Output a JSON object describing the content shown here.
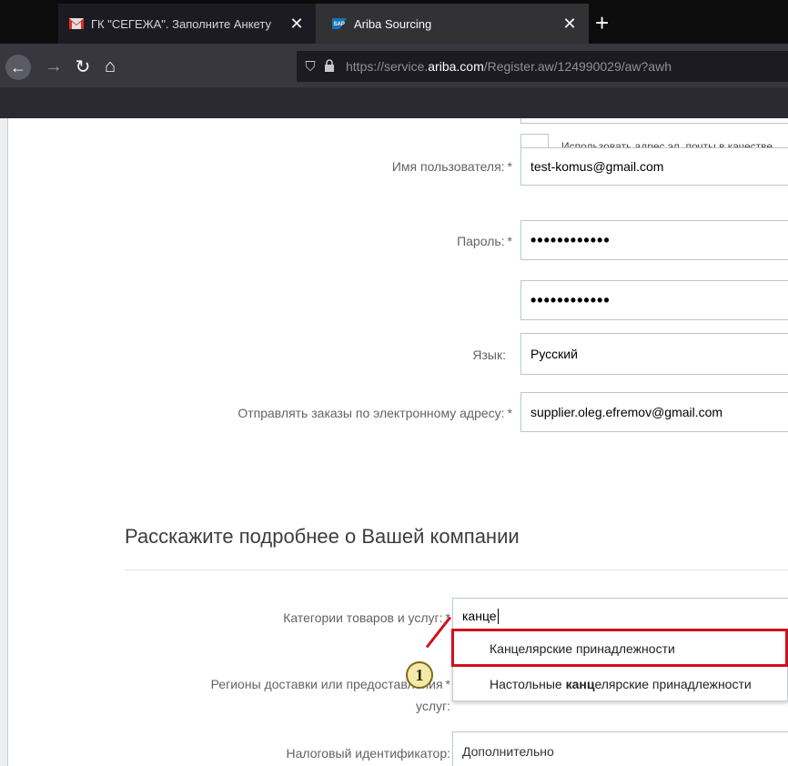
{
  "browser": {
    "tabs": [
      {
        "title": "ГК \"СЕГЕЖА\". Заполните Анкету",
        "close": "✕",
        "favicon": "gmail-icon"
      },
      {
        "title": "Ariba Sourcing",
        "close": "✕",
        "favicon": "sap-icon"
      }
    ],
    "new_tab": "+",
    "nav": {
      "back": "←",
      "forward": "→",
      "reload": "↻",
      "home": "⌂"
    },
    "url": {
      "prefix": "https://service.",
      "host": "ariba.com",
      "path": "/Register.aw/124990029/aw?awh"
    }
  },
  "form": {
    "checkbox_label": "Использовать адрес эл. почты в качестве",
    "username": {
      "label": "Имя пользователя:",
      "required": "*",
      "value": "test-komus@gmail.com"
    },
    "password": {
      "label": "Пароль:",
      "required": "*",
      "value": "••••••••••••"
    },
    "password_confirm": {
      "value": "••••••••••••"
    },
    "language": {
      "label": "Язык:",
      "value": "Русский"
    },
    "order_email": {
      "label": "Отправлять заказы по электронному адресу:",
      "required": "*",
      "value": "supplier.oleg.efremov@gmail.com"
    }
  },
  "company": {
    "section_title": "Расскажите подробнее о Вашей компании",
    "categories": {
      "label": "Категории товаров и услуг:",
      "required": "*",
      "value": "канце"
    },
    "regions": {
      "label_line1": "Регионы доставки или предоставления",
      "label_line2": "услуг:",
      "required": "*"
    },
    "tax_id": {
      "label": "Налоговый идентификатор:",
      "value": "Дополнительно"
    }
  },
  "dropdown": {
    "items": [
      {
        "text": "Канцелярские принадлежности"
      },
      {
        "prefix": "Настольные ",
        "match": "канц",
        "suffix": "елярские принадлежности"
      }
    ]
  },
  "annotation": {
    "number": "1",
    "color": "#d0101d"
  }
}
